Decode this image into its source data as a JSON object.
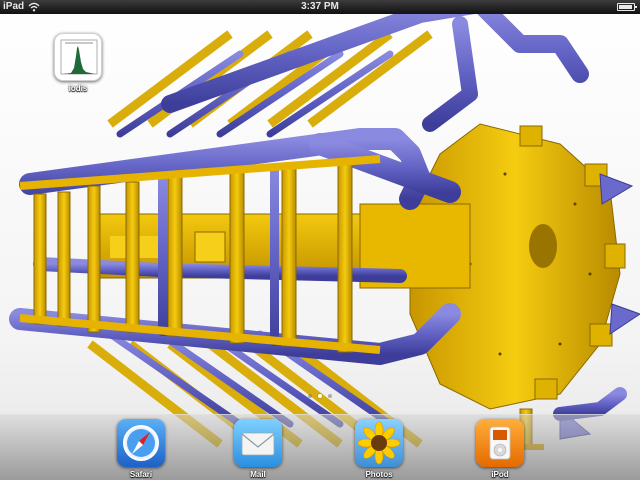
{
  "status_bar": {
    "device": "iPad",
    "time": "3:37 PM"
  },
  "home_screen": {
    "apps": [
      {
        "label": "iodis",
        "icon": "histogram-app-icon"
      }
    ],
    "page_count": 3,
    "active_page": 1
  },
  "dock": {
    "apps": [
      {
        "label": "Safari",
        "icon": "compass-icon"
      },
      {
        "label": "Mail",
        "icon": "envelope-icon"
      },
      {
        "label": "Photos",
        "icon": "sunflower-icon"
      },
      {
        "label": "iPod",
        "icon": "ipod-icon"
      }
    ]
  },
  "wallpaper": {
    "subject": "detector-structure-3d",
    "colors": {
      "frame": "#e8b800",
      "tubes": "#6464c8"
    }
  }
}
